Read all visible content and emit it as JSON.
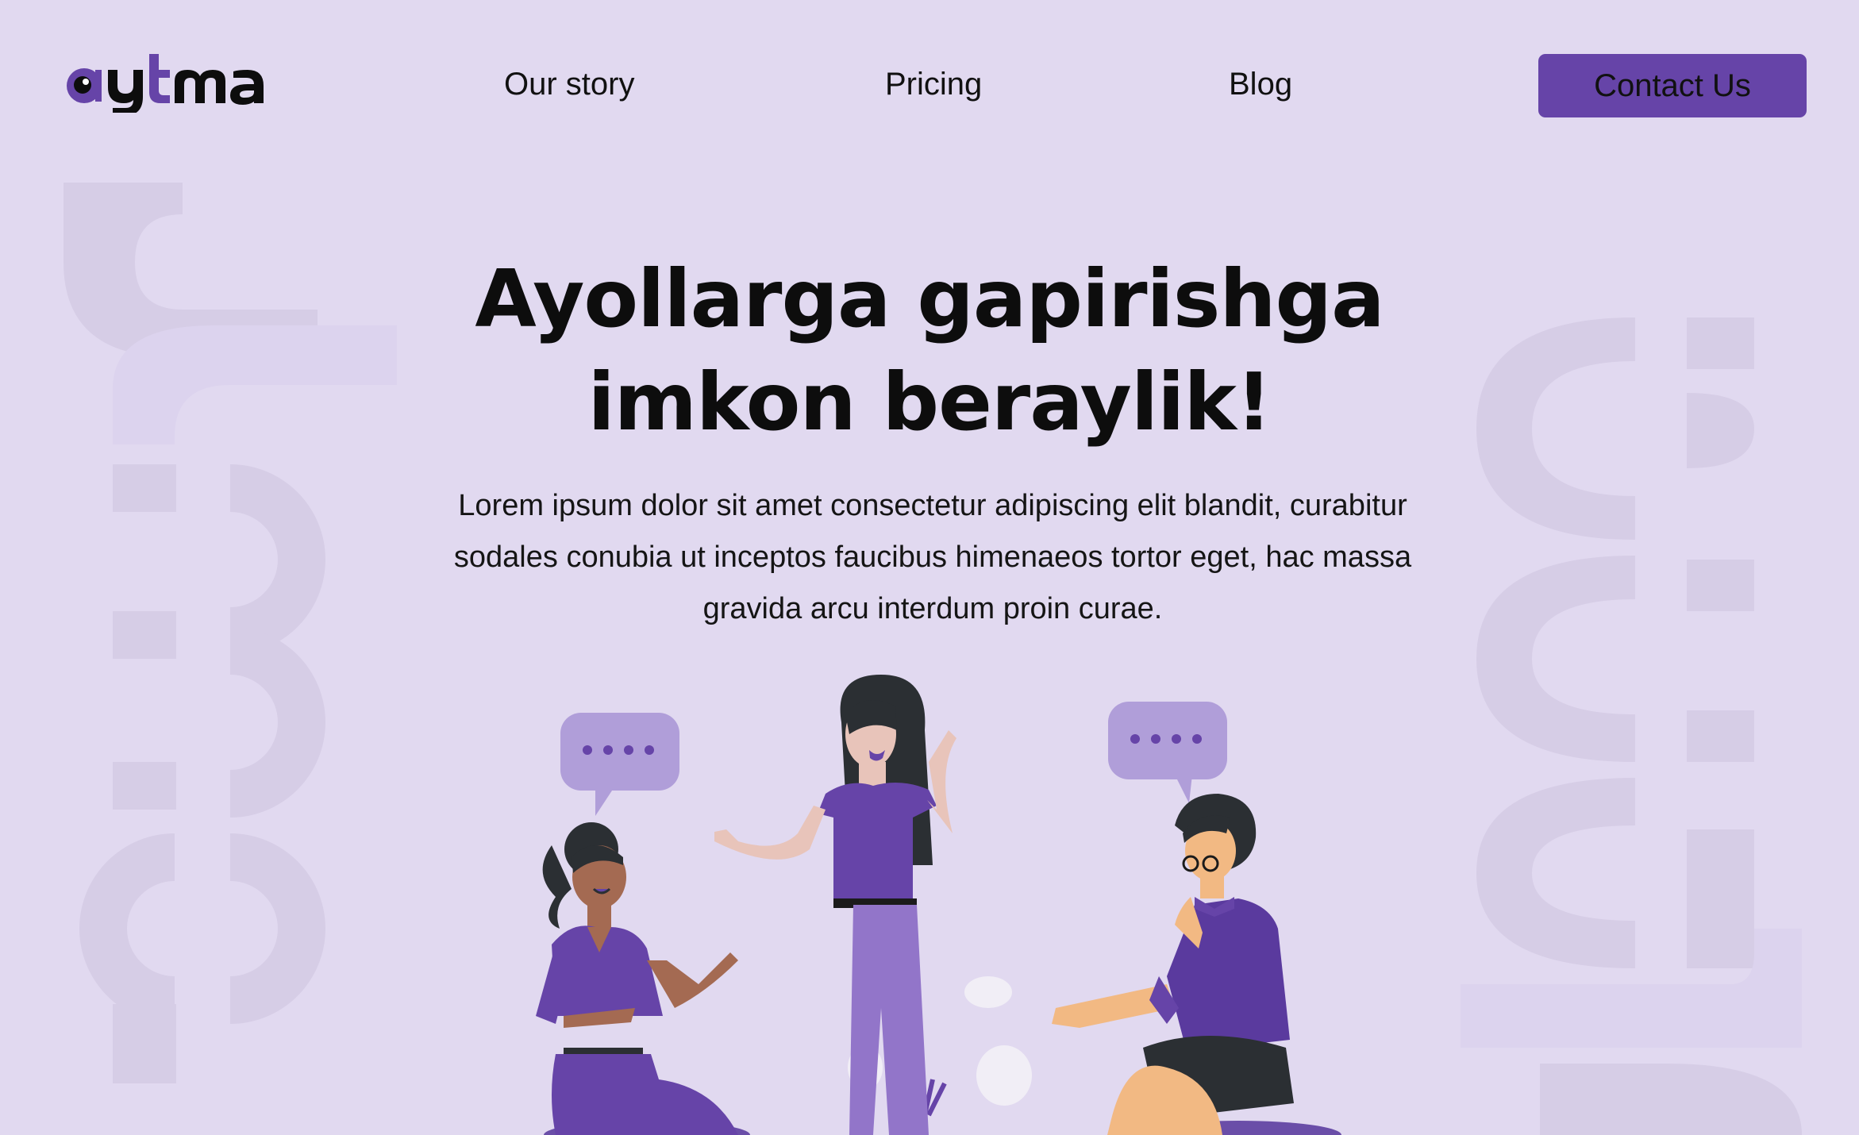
{
  "brand": {
    "logo_text": "aytma"
  },
  "nav": {
    "links": [
      {
        "label": "Our story"
      },
      {
        "label": "Pricing"
      },
      {
        "label": "Blog"
      }
    ],
    "cta_label": "Contact Us"
  },
  "hero": {
    "title_line1": "Ayollarga gapirishga",
    "title_line2": "imkon beraylik!",
    "subtitle": "Lorem ipsum dolor sit amet consectetur adipiscing elit blandit, curabitur sodales conubia ut inceptos faucibus himenaeos tortor eget, hac massa gravida arcu interdum proin curae."
  },
  "illustration": {
    "icon": "women-talking-illustration"
  },
  "colors": {
    "background": "#e1d9f0",
    "accent": "#6644a8",
    "accent_light": "#b09ed9",
    "watermark": "#d6cde6"
  }
}
